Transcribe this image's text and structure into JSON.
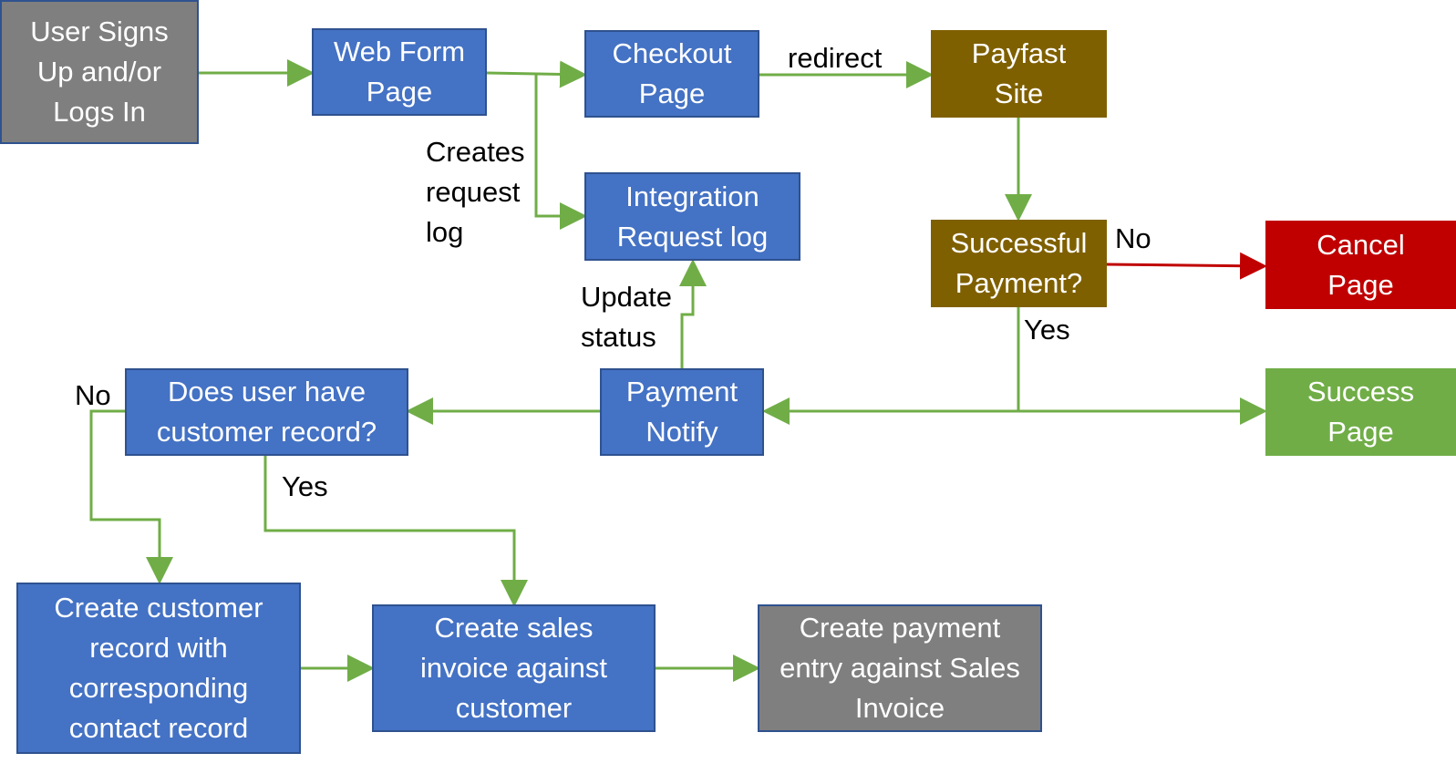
{
  "nodes": {
    "signup": "User Signs\nUp and/or\nLogs In",
    "webform": "Web Form\nPage",
    "checkout": "Checkout\nPage",
    "payfast": "Payfast\nSite",
    "integration": "Integration\nRequest log",
    "successful": "Successful\nPayment?",
    "cancel": "Cancel\nPage",
    "success": "Success\nPage",
    "notify": "Payment\nNotify",
    "hascustomer": "Does user have\ncustomer record?",
    "createcustomer": "Create customer\nrecord with\ncorresponding\ncontact record",
    "salesinvoice": "Create sales\ninvoice against\ncustomer",
    "paymententry": "Create payment\nentry against Sales\nInvoice"
  },
  "labels": {
    "redirect": "redirect",
    "creates": "Creates\nrequest\nlog",
    "update": "Update\nstatus",
    "no_payment": "No",
    "yes_payment": "Yes",
    "no_customer": "No",
    "yes_customer": "Yes"
  },
  "colors": {
    "connector": "#70ad47",
    "cancel_connector": "#c00000"
  }
}
